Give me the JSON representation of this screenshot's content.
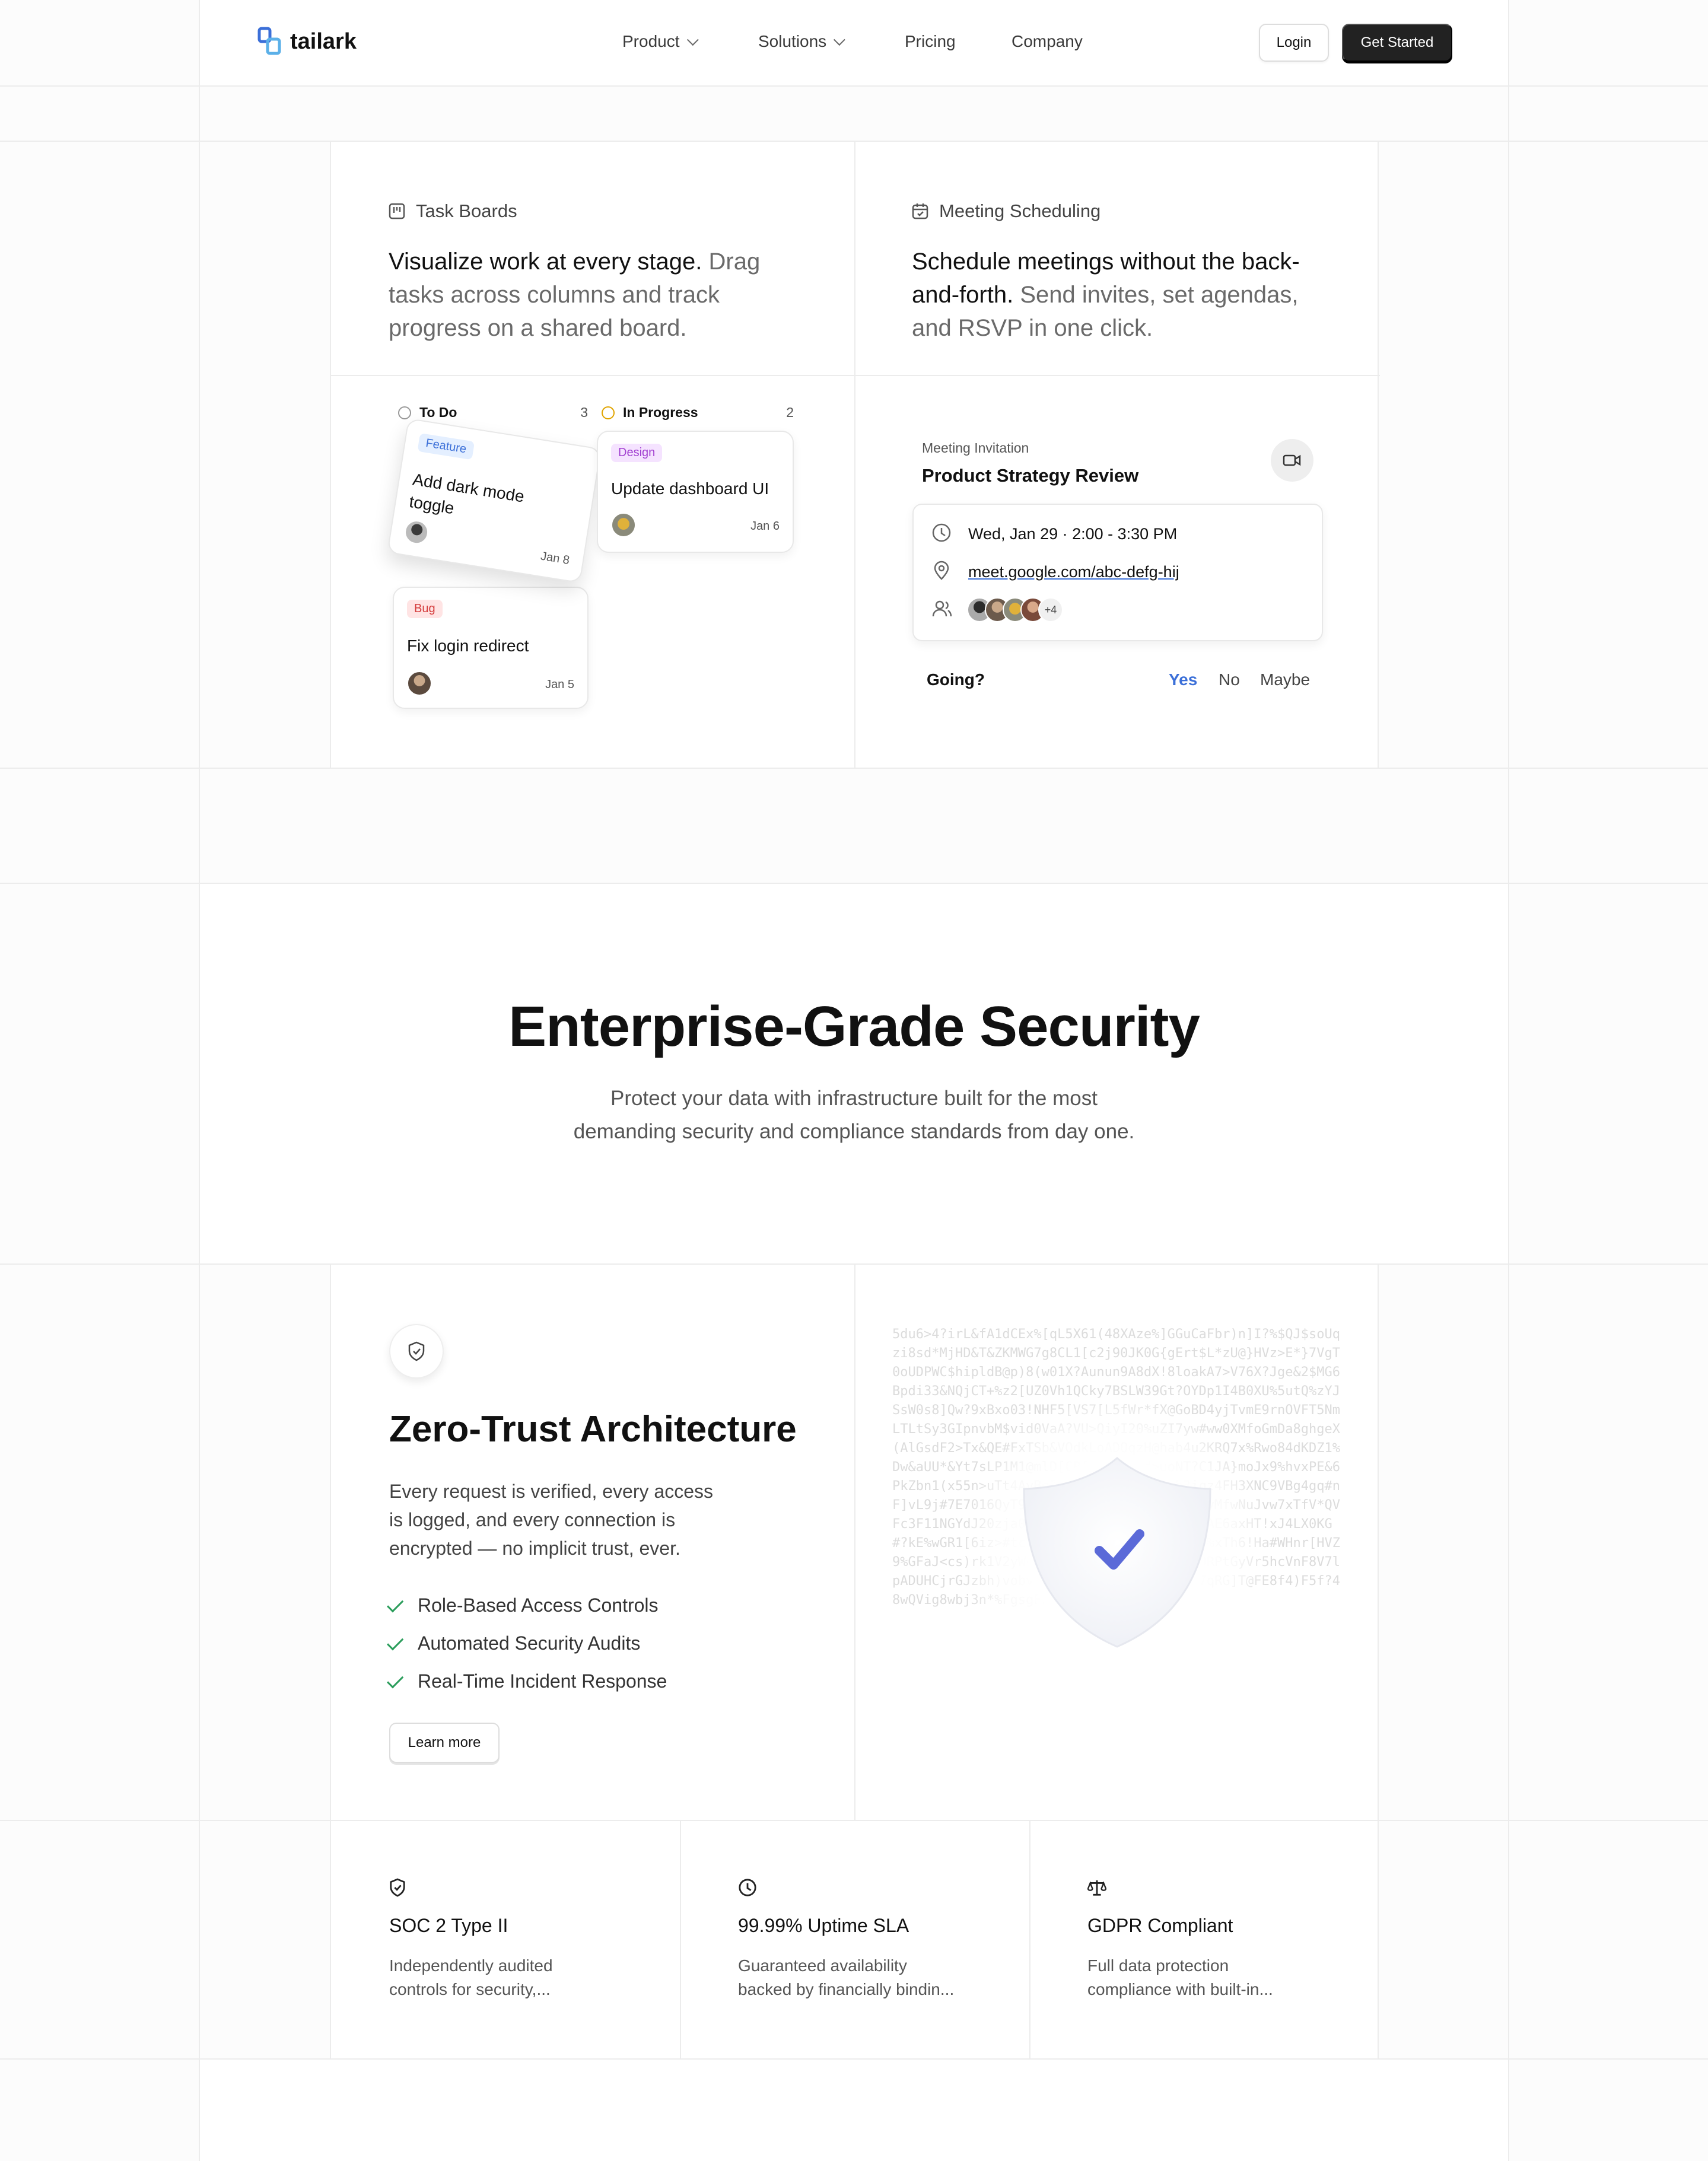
{
  "nav": {
    "brand": "tailark",
    "links": [
      {
        "label": "Product",
        "has_menu": true
      },
      {
        "label": "Solutions",
        "has_menu": true
      },
      {
        "label": "Pricing",
        "has_menu": false
      },
      {
        "label": "Company",
        "has_menu": false
      }
    ],
    "login_label": "Login",
    "cta_label": "Get Started"
  },
  "features": [
    {
      "label": "Task Boards",
      "headline_strong": "Visualize work at every stage.",
      "headline_rest": " Drag tasks across columns and track progress on a shared board."
    },
    {
      "label": "Meeting Scheduling",
      "headline_strong": "Schedule meetings without the back-and-forth.",
      "headline_rest": " Send invites, set agendas, and RSVP in one click."
    }
  ],
  "board": {
    "todo": {
      "title": "To Do",
      "count": "3"
    },
    "in_progress": {
      "title": "In Progress",
      "count": "2"
    },
    "cards": {
      "dark_mode": {
        "tag": "Feature",
        "title": "Add dark mode toggle",
        "date": "Jan 8"
      },
      "login": {
        "tag": "Bug",
        "title": "Fix login redirect",
        "date": "Jan 5"
      },
      "dashboard": {
        "tag": "Design",
        "title": "Update dashboard UI",
        "date": "Jan 6"
      }
    }
  },
  "meeting": {
    "eyebrow": "Meeting Invitation",
    "title": "Product Strategy Review",
    "datetime": "Wed, Jan 29 · 2:00 - 3:30 PM",
    "link": "meet.google.com/abc-defg-hij",
    "extra_attendees": "+4",
    "rsvp_question": "Going?",
    "rsvp_options": [
      "Yes",
      "No",
      "Maybe"
    ],
    "rsvp_selected": "Yes"
  },
  "security": {
    "title": "Enterprise-Grade Security",
    "subtitle_line1": "Protect your data with infrastructure built for the most",
    "subtitle_line2": "demanding security and compliance standards from day one."
  },
  "zero_trust": {
    "title": "Zero-Trust Architecture",
    "desc_lines": [
      "Every request is verified, every access",
      "is logged, and every connection is",
      "encrypted — no implicit trust, ever."
    ],
    "checklist": [
      "Role-Based Access Controls",
      "Automated Security Audits",
      "Real-Time Incident Response"
    ],
    "cta_label": "Learn more",
    "code_text": "5du6>4?irL&fA1dCEx%[qL5X61(48XAze%]GGuCaFbr)n]I?%$QJ$soUqzi8sd*MjHD&T&ZKMWG7g8CL1[c2j90JK0G{gErt$L*zU@}HVz>E*}7VgT0oUDPWC$hipldB@p)8(w01X?Aunun9A8dX!8loakA7>V76X?Jge&2$MG6Bpdi33&NQjCT+%z2[UZ0Vh1QCky7BSLW39Gt?OYDp1I4B0XU%5utQ%zYJSsW0s8]Qw?9xBxo03!NHF5[VS7[L5fWr*fX@GoBD4yjTvmE9rnOVFT5NmLTLtSy3GIpnvbM$vid0VaA?VU>QiyI20%uZI7yw#ww0XMfoGmDa8ghgeX(AlGsdF2>Tx&QE#FxTSb&VOdkLoADOqzH@hab4u2KRQ7x%Rwo84dKDZ1%Dw&aUU*&Yt7sLP1M1@mlD[CR[tm65t3Od>uoNT?C1JA}moJx9%hvxPE&6PkZbn1(x55n>uTt4AyBg7uGNmuUV#!QYNGH{b3iqz4FH3XNC9VBg4gq#nF]vL9j#7E7016QyT9QAEd#Y00UBAtkkeNDcGTTE#yMfwNuJvw7xTfV*QVFc3F11NGYdJ20zja0W7#&JjBbHHLZNZe3M0xVAw<AE6axHT!xJ4LX0KG#?kE%wGR1[6iz>#tcA>ngzzn0K>?rSLb>pDop(8>%xTh6!Ha#WHnr[HVZ9%GFaJ<cs)rk1V2yWhS3fg06#z3TCaDpRy7hJBv9RPtGyVr5hcVnF8V7lpADUHCjrGJzbh)vobv*@Aeqr0RRLRP(ZFBXfjGb7qRG]T@FE8f4)F5f?48wQVig8wbj3n*%FgsgFPO[wA?"
  },
  "stats": [
    {
      "icon": "shield-icon",
      "title": "SOC 2 Type II",
      "desc_lines": [
        "Independently audited",
        "controls for security,..."
      ]
    },
    {
      "icon": "clock-icon",
      "title": "99.99% Uptime SLA",
      "desc_lines": [
        "Guaranteed availability",
        "backed by financially bindin..."
      ]
    },
    {
      "icon": "scale-icon",
      "title": "GDPR Compliant",
      "desc_lines": [
        "Full data protection",
        "compliance with built-in..."
      ]
    }
  ],
  "colors": {
    "accent_blue": "#3b6fd8",
    "shield_check": "#5b6ad8",
    "check_green": "#2a9d5b",
    "tag_feature": "#e4efff",
    "tag_bug": "#ffe4e4",
    "tag_design": "#f5e3ff"
  }
}
